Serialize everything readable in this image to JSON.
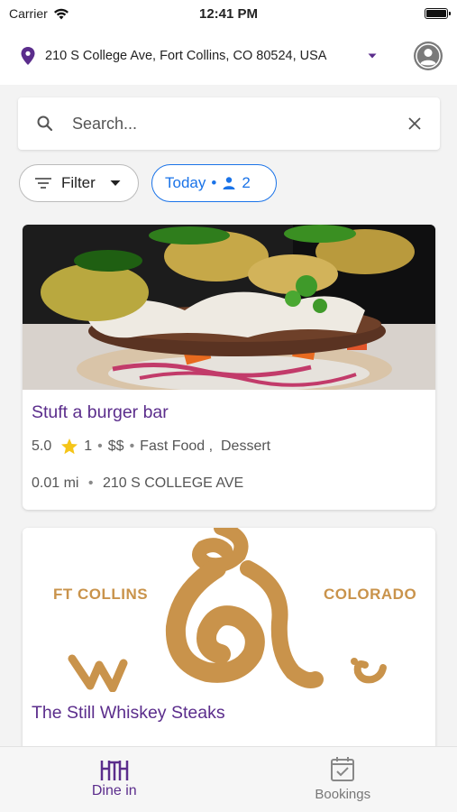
{
  "status_bar": {
    "carrier": "Carrier",
    "time": "12:41 PM"
  },
  "location": {
    "address": "210 S College Ave, Fort Collins, CO 80524, USA",
    "pin_color": "#5b2d8c"
  },
  "search": {
    "placeholder": "Search..."
  },
  "chips": {
    "filter_label": "Filter",
    "date_label": "Today",
    "separator": "•",
    "party_size": "2"
  },
  "restaurants": [
    {
      "name": "Stuft a burger bar",
      "rating": "5.0",
      "reviews": "1",
      "dot1": "•",
      "price": "$$",
      "dot2": "•",
      "cuisine": "Fast Food ,  Dessert",
      "distance": "0.01 mi",
      "dot3": "•",
      "address": "210 S COLLEGE AVE"
    },
    {
      "name": "The Still Whiskey Steaks",
      "logo_left": "FT COLLINS",
      "logo_right": "COLORADO"
    }
  ],
  "bottom_nav": {
    "dine_in": "Dine in",
    "bookings": "Bookings"
  },
  "colors": {
    "brand_purple": "#5b2d8c",
    "accent_blue": "#1a73e8",
    "star_yellow": "#f5c518",
    "logo_gold": "#c9934b"
  }
}
